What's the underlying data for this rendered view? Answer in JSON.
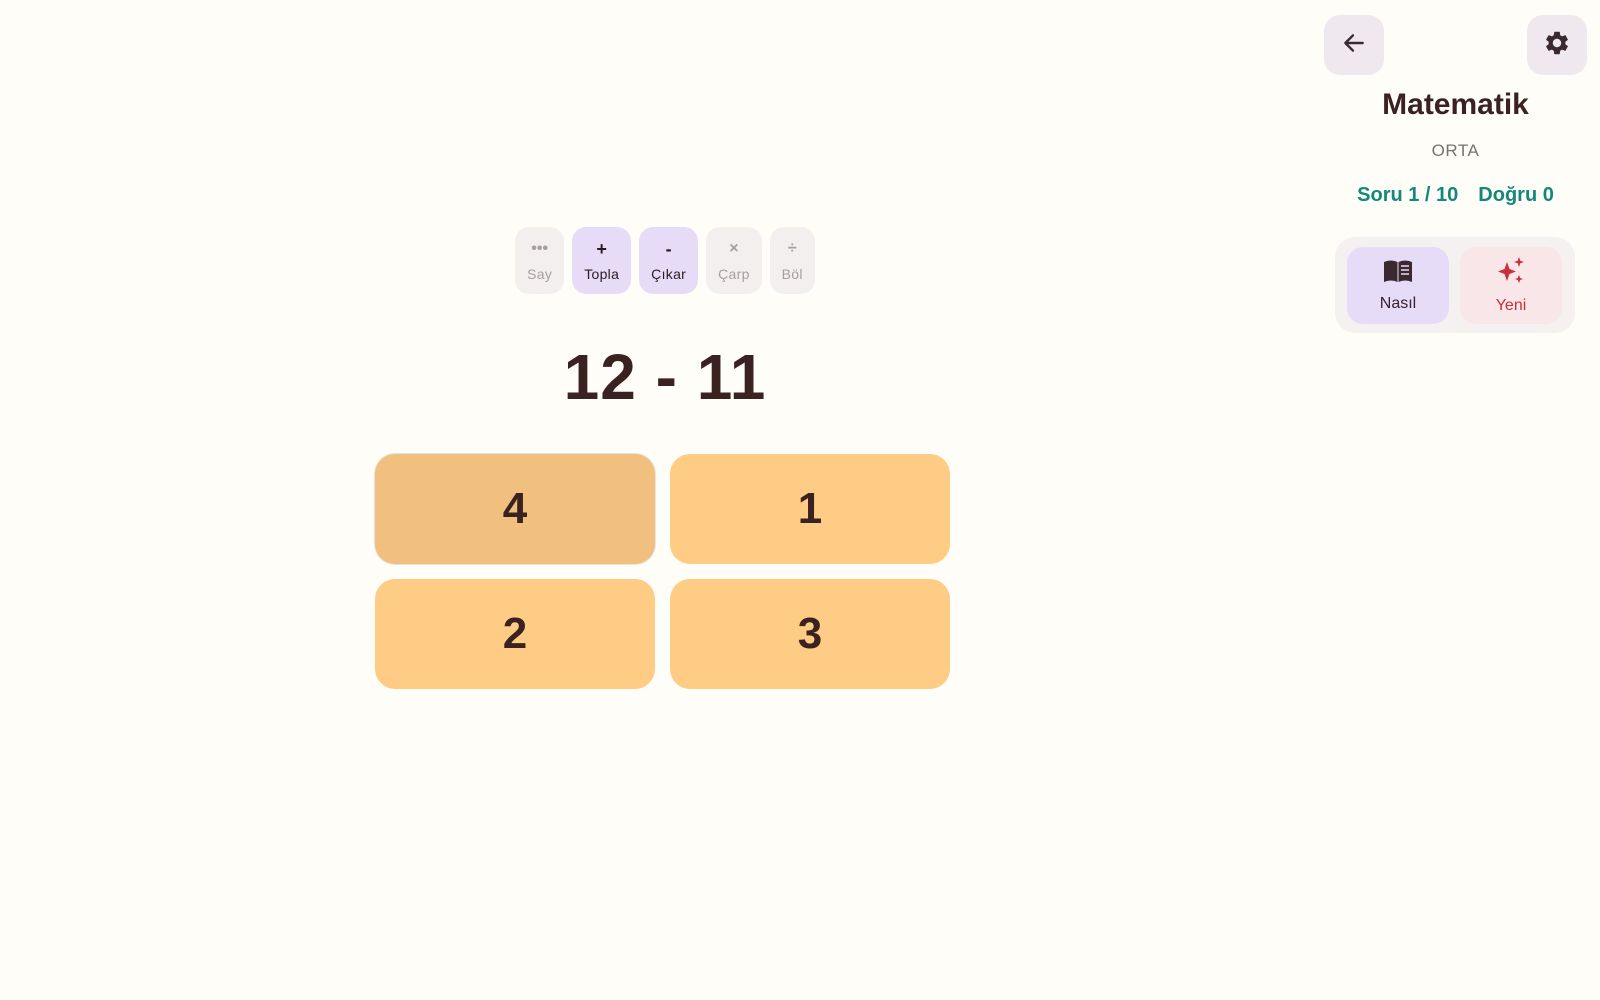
{
  "modes": [
    {
      "symbol": "•••",
      "label": "Say",
      "state": "disabled"
    },
    {
      "symbol": "+",
      "label": "Topla",
      "state": "enabled"
    },
    {
      "symbol": "-",
      "label": "Çıkar",
      "state": "enabled"
    },
    {
      "symbol": "×",
      "label": "Çarp",
      "state": "disabled"
    },
    {
      "symbol": "÷",
      "label": "Böl",
      "state": "disabled"
    }
  ],
  "question": "12 - 11",
  "answers": [
    "4",
    "1",
    "2",
    "3"
  ],
  "header": {
    "title": "Matematik",
    "level": "ORTA",
    "question_progress": "Soru 1 / 10",
    "correct": "Doğru 0"
  },
  "actions": {
    "how_label": "Nasıl",
    "new_label": "Yeni"
  },
  "icons": {
    "back": "arrow-left-icon",
    "settings": "gear-icon",
    "how": "book-icon",
    "new": "sparkle-icon"
  },
  "colors": {
    "background": "#fffdf8",
    "answer": "#ffcc85",
    "answer_focused": "#f1c07e",
    "chip_enabled": "#e6dcf8",
    "chip_disabled": "#f3efef",
    "stats": "#12897a",
    "new_accent": "#c9303a"
  }
}
